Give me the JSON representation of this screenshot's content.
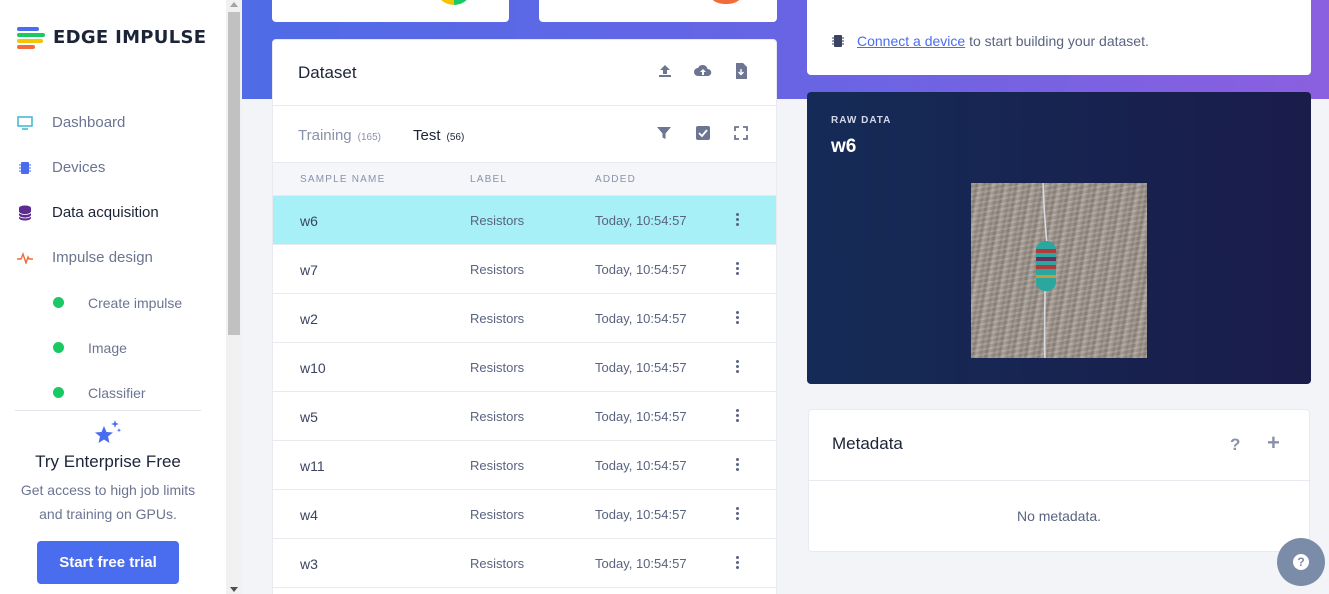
{
  "brand": {
    "name": "EDGE IMPULSE"
  },
  "sidebar": {
    "items": [
      {
        "label": "Dashboard",
        "icon": "monitor-icon"
      },
      {
        "label": "Devices",
        "icon": "chip-icon"
      },
      {
        "label": "Data acquisition",
        "icon": "database-icon"
      },
      {
        "label": "Impulse design",
        "icon": "pulse-icon"
      }
    ],
    "subitems": [
      {
        "label": "Create impulse"
      },
      {
        "label": "Image"
      },
      {
        "label": "Classifier"
      }
    ],
    "promo": {
      "title": "Try Enterprise Free",
      "text_line1": "Get access to high job limits",
      "text_line2": "and training on GPUs.",
      "button": "Start free trial"
    }
  },
  "dataset": {
    "title": "Dataset",
    "tabs": [
      {
        "label": "Training",
        "count": "(165)"
      },
      {
        "label": "Test",
        "count": "(56)"
      }
    ],
    "columns": [
      "SAMPLE NAME",
      "LABEL",
      "ADDED"
    ],
    "rows": [
      {
        "name": "w6",
        "label": "Resistors",
        "added": "Today, 10:54:57"
      },
      {
        "name": "w7",
        "label": "Resistors",
        "added": "Today, 10:54:57"
      },
      {
        "name": "w2",
        "label": "Resistors",
        "added": "Today, 10:54:57"
      },
      {
        "name": "w10",
        "label": "Resistors",
        "added": "Today, 10:54:57"
      },
      {
        "name": "w5",
        "label": "Resistors",
        "added": "Today, 10:54:57"
      },
      {
        "name": "w11",
        "label": "Resistors",
        "added": "Today, 10:54:57"
      },
      {
        "name": "w4",
        "label": "Resistors",
        "added": "Today, 10:54:57"
      },
      {
        "name": "w3",
        "label": "Resistors",
        "added": "Today, 10:54:57"
      }
    ]
  },
  "connect": {
    "link": "Connect a device",
    "text": " to start building your dataset."
  },
  "raw_data": {
    "label": "RAW DATA",
    "name": "w6"
  },
  "metadata": {
    "title": "Metadata",
    "empty": "No metadata.",
    "help": "?",
    "add": "+"
  },
  "colors": {
    "accent": "#4a6cee",
    "selected_row": "#a8f0f8",
    "status_green": "#18c964"
  }
}
